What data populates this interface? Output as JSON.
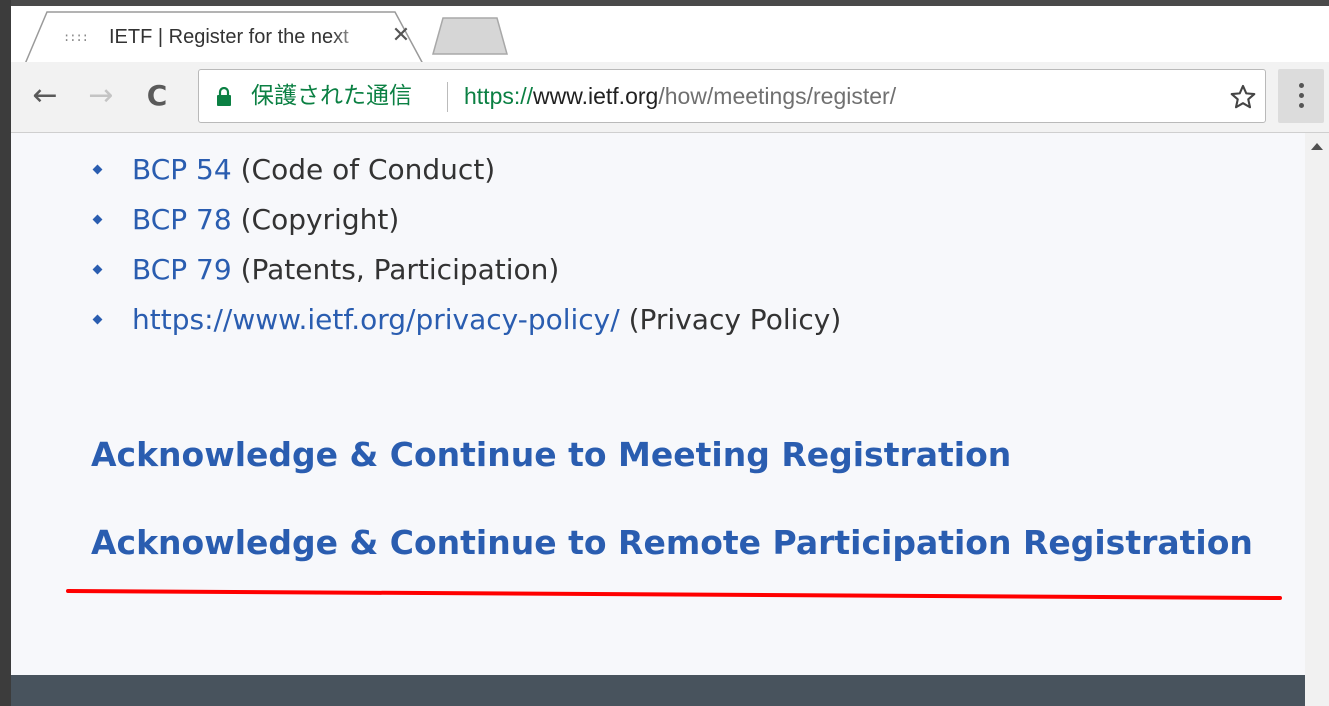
{
  "tab": {
    "title": "IETF | Register for the next",
    "close_glyph": "✕",
    "favicon_text": "::::"
  },
  "toolbar": {
    "back_glyph": "←",
    "forward_glyph": "→",
    "reload_glyph": "C",
    "secure_label": "保護された通信",
    "url_scheme": "https://",
    "url_host": "www.ietf.org",
    "url_path": "/how/meetings/register/"
  },
  "list": [
    {
      "link": "BCP 54",
      "note": " (Code of Conduct)"
    },
    {
      "link": "BCP 78",
      "note": " (Copyright)"
    },
    {
      "link": "BCP 79",
      "note": " (Patents, Participation)"
    },
    {
      "link": "https://www.ietf.org/privacy-policy/",
      "note": " (Privacy Policy)"
    }
  ],
  "actions": {
    "meeting": "Acknowledge & Continue to Meeting Registration",
    "remote": "Acknowledge & Continue to Remote Participation Registration"
  },
  "colors": {
    "link": "#2a5db0",
    "secure": "#0b8043",
    "annotation": "#ff0000",
    "footer": "#48535d"
  },
  "icons": {
    "lock": "lock-icon",
    "star": "star-icon",
    "menu": "kebab-menu-icon"
  }
}
